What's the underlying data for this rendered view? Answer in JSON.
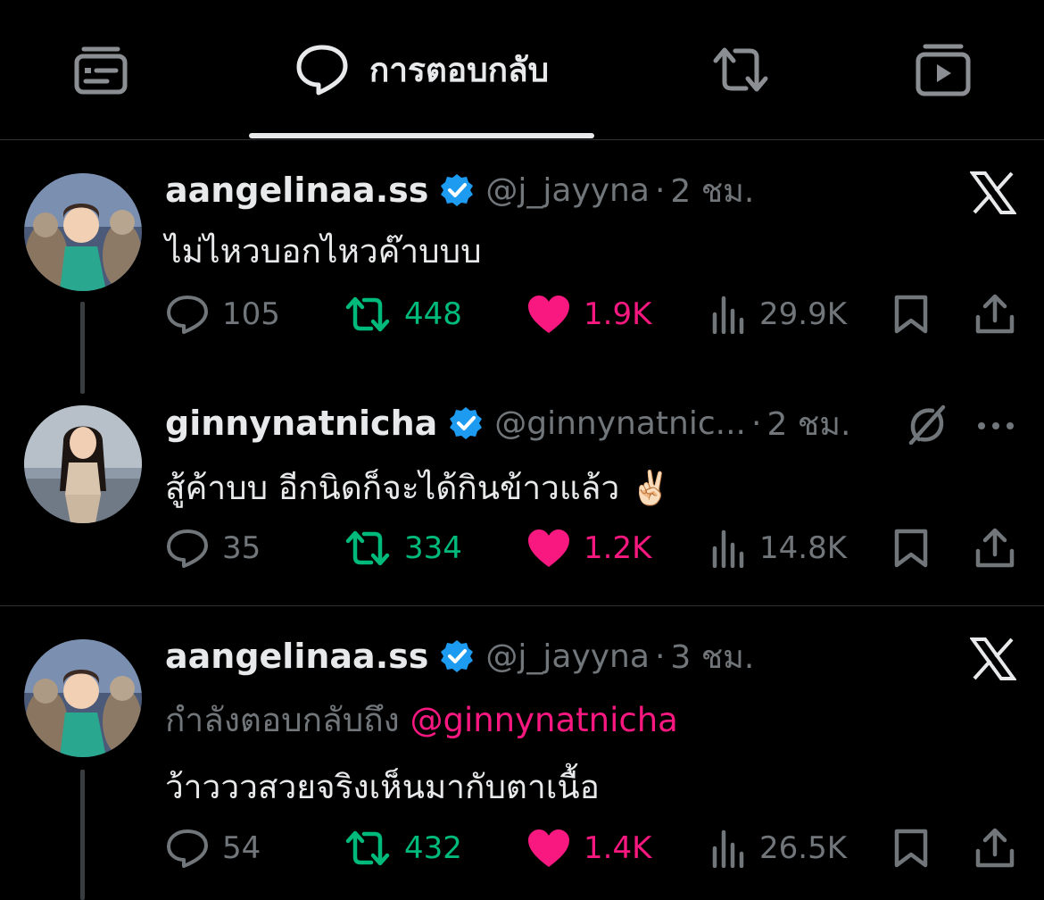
{
  "tabs": {
    "active_label": "การตอบกลับ"
  },
  "posts": [
    {
      "name": "aangelinaa.ss",
      "handle": "@j_jayyna",
      "dot": "·",
      "time": "2 ชม.",
      "text": "ไม่ไหวบอกไหวค๊าบบบ",
      "replies": "105",
      "reposts": "448",
      "likes": "1.9K",
      "views": "29.9K",
      "corner_icon": "x-logo-icon"
    },
    {
      "name": "ginnynatnicha",
      "handle": "@ginnynatnic...",
      "dot": "·",
      "time": "2 ชม.",
      "text": "สู้ค้าบบ อีกนิดก็จะได้กินข้าวแล้ว ✌🏻",
      "replies": "35",
      "reposts": "334",
      "likes": "1.2K",
      "views": "14.8K",
      "corner_icon": "grok-icon"
    },
    {
      "name": "aangelinaa.ss",
      "handle": "@j_jayyna",
      "dot": "·",
      "time": "3 ชม.",
      "reply_prefix": "กำลังตอบกลับถึง",
      "reply_mention": "@ginnynatnicha",
      "text": "ว้าวววสวยจริงเห็นมากับตาเนื้อ",
      "replies": "54",
      "reposts": "432",
      "likes": "1.4K",
      "views": "26.5K",
      "corner_icon": "x-logo-icon"
    }
  ],
  "colors": {
    "background": "#000000",
    "text": "#e7e9ea",
    "secondary": "#71767b",
    "repost_green": "#00ba7c",
    "like_pink": "#f91880",
    "verified_blue": "#1d9bf0"
  }
}
